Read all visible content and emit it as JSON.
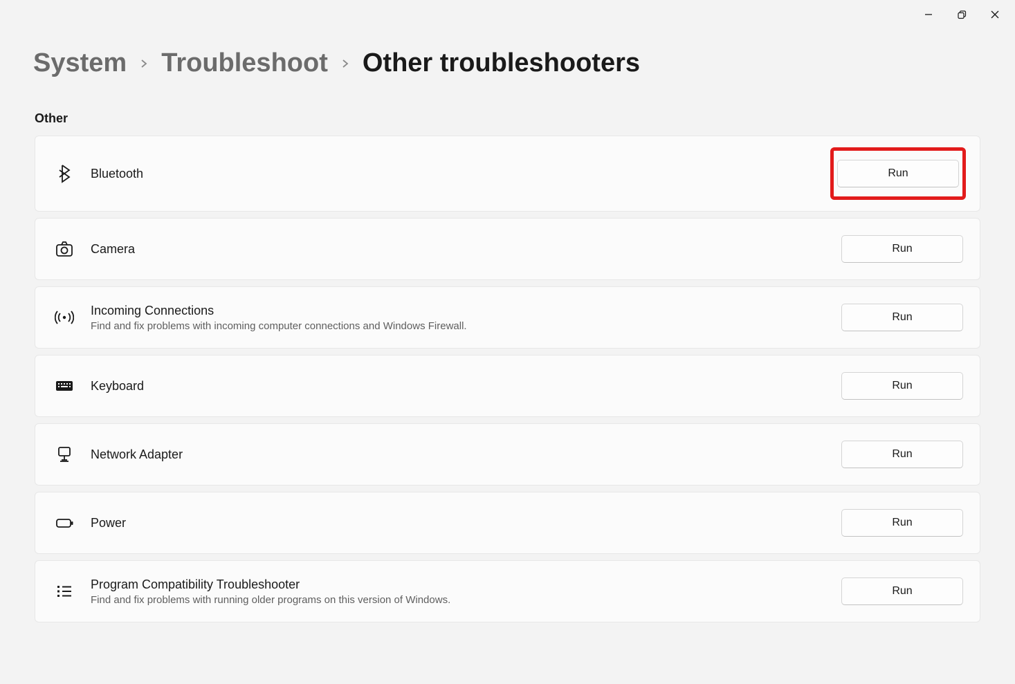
{
  "breadcrumb": {
    "root": "System",
    "parent": "Troubleshoot",
    "current": "Other troubleshooters"
  },
  "section_header": "Other",
  "run_label": "Run",
  "items": [
    {
      "id": "bluetooth",
      "title": "Bluetooth",
      "desc": "",
      "icon": "bluetooth-icon",
      "highlighted": true
    },
    {
      "id": "camera",
      "title": "Camera",
      "desc": "",
      "icon": "camera-icon",
      "highlighted": false
    },
    {
      "id": "incoming-connections",
      "title": "Incoming Connections",
      "desc": "Find and fix problems with incoming computer connections and Windows Firewall.",
      "icon": "signal-icon",
      "highlighted": false
    },
    {
      "id": "keyboard",
      "title": "Keyboard",
      "desc": "",
      "icon": "keyboard-icon",
      "highlighted": false
    },
    {
      "id": "network-adapter",
      "title": "Network Adapter",
      "desc": "",
      "icon": "network-icon",
      "highlighted": false
    },
    {
      "id": "power",
      "title": "Power",
      "desc": "",
      "icon": "battery-icon",
      "highlighted": false
    },
    {
      "id": "program-compat",
      "title": "Program Compatibility Troubleshooter",
      "desc": "Find and fix problems with running older programs on this version of Windows.",
      "icon": "list-icon",
      "highlighted": false
    }
  ]
}
